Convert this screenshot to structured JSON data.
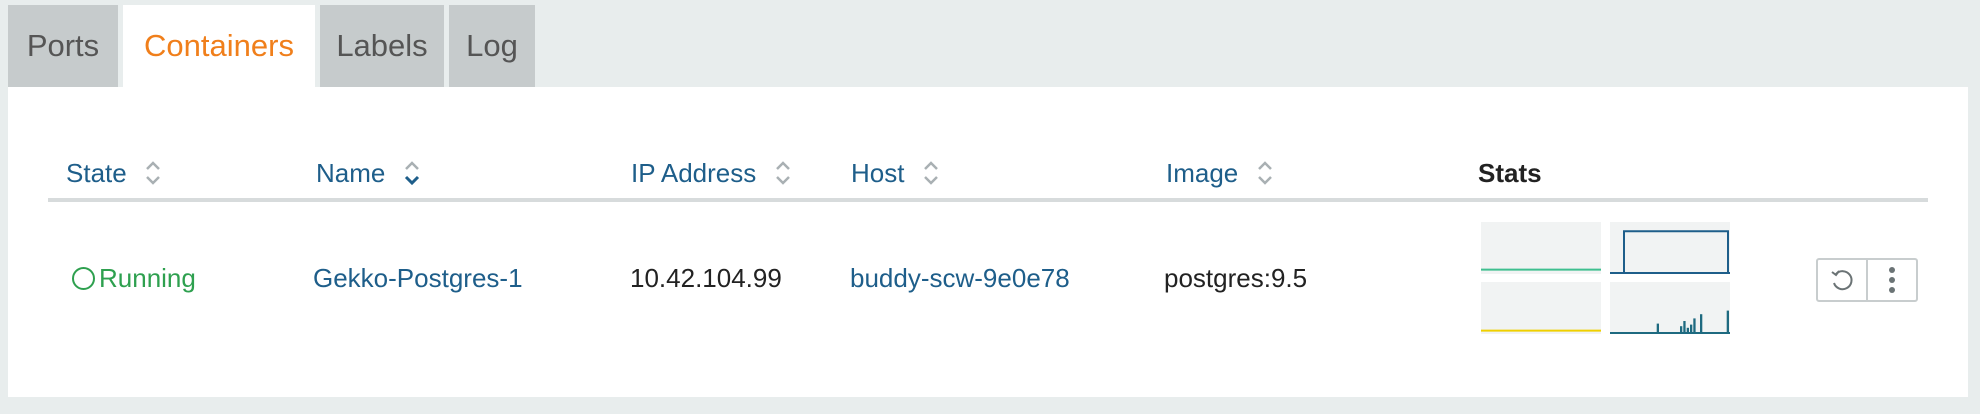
{
  "tabs": [
    {
      "label": "Ports",
      "active": false
    },
    {
      "label": "Containers",
      "active": true
    },
    {
      "label": "Labels",
      "active": false
    },
    {
      "label": "Log",
      "active": false
    }
  ],
  "table": {
    "columns": {
      "state": "State",
      "name": "Name",
      "ip": "IP Address",
      "host": "Host",
      "image": "Image",
      "stats": "Stats"
    },
    "sorted_column": "name",
    "rows": [
      {
        "state": "Running",
        "name": "Gekko-Postgres-1",
        "ip": "10.42.104.99",
        "host": "buddy-scw-9e0e78",
        "image": "postgres:9.5"
      }
    ]
  },
  "stats": {
    "cpu": {
      "color": "#3fbf8f",
      "values": [
        0.05,
        0.05,
        0.05,
        0.05,
        0.05,
        0.05,
        0.05,
        0.05,
        0.05,
        0.05
      ]
    },
    "memory": {
      "color": "#1e5e8a",
      "values": [
        0.05,
        0.05,
        0.85,
        0.85,
        0.85,
        0.85,
        0.85,
        0.85,
        0.85,
        0.85
      ]
    },
    "network": {
      "color": "#f0d000",
      "values": [
        0.03,
        0.03,
        0.03,
        0.03,
        0.03,
        0.03,
        0.03,
        0.03,
        0.03,
        0.03
      ]
    },
    "storage": {
      "color": "#1e6a80",
      "bars": [
        0,
        0,
        0,
        0,
        0,
        0,
        0,
        0,
        0,
        0,
        0,
        0,
        0,
        0,
        0.2,
        0,
        0,
        0,
        0,
        0,
        0,
        0.15,
        0.25,
        0.12,
        0.18,
        0.3,
        0,
        0.38,
        0,
        0,
        0,
        0,
        0,
        0,
        0,
        0.45
      ]
    }
  },
  "actions": {
    "restart_icon": "restart-icon",
    "menu_icon": "kebab-menu-icon"
  },
  "colors": {
    "active_tab": "#f07f1b",
    "link": "#1e5e8a",
    "running": "#2ea04f"
  }
}
